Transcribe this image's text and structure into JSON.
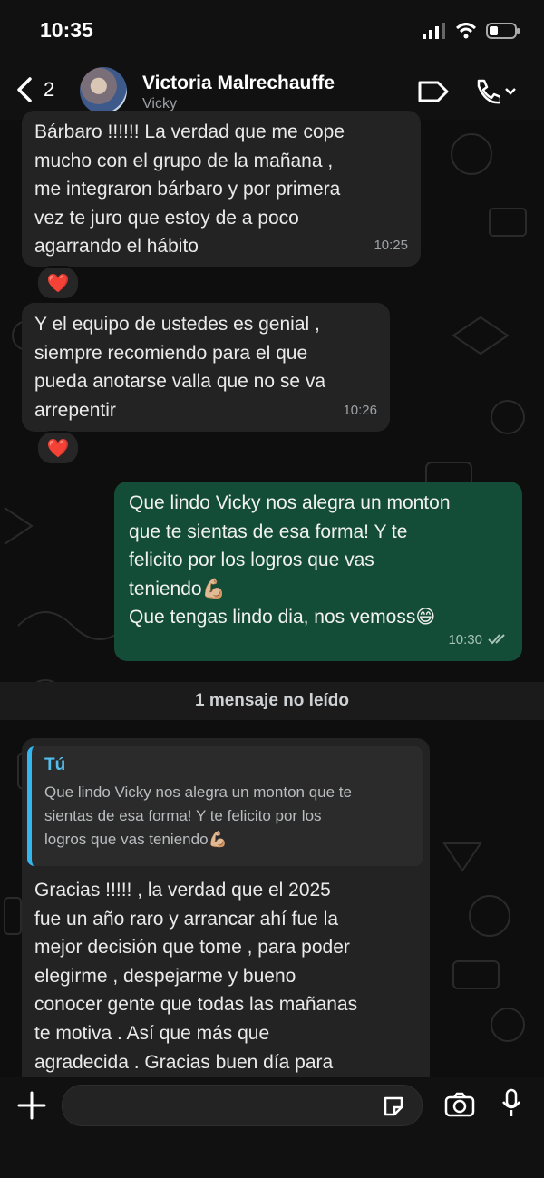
{
  "status": {
    "time": "10:35"
  },
  "header": {
    "back_count": "2",
    "contact_name": "Victoria Malrechauffe",
    "contact_subtitle": "Vicky"
  },
  "messages": [
    {
      "direction": "incoming",
      "text": "Bárbaro !!!!!! La verdad que me cope\nmucho con el grupo de la mañana ,\nme integraron bárbaro  y por primera\nvez te juro que estoy de a poco\nagarrando el hábito",
      "time": "10:25",
      "reaction": "❤️"
    },
    {
      "direction": "incoming",
      "text": "Y el equipo de ustedes es genial ,\nsiempre recomiendo para el que\npueda anotarse valla que no se va\narrepentir",
      "time": "10:26",
      "reaction": "❤️"
    },
    {
      "direction": "outgoing",
      "text": "Que lindo Vicky nos alegra un monton\nque te sientas de esa forma! Y te\nfelicito por los logros que vas\nteniendo💪🏼\nQue tengas lindo dia, nos vemoss😄",
      "time": "10:30"
    },
    {
      "direction": "incoming",
      "reply_to": {
        "author": "Tú",
        "text": "Que lindo Vicky nos alegra un monton que te\nsientas de esa forma! Y te felicito por los\nlogros que vas teniendo💪🏼"
      },
      "text": "Gracias !!!!! , la verdad que el 2025\nfue un año raro y arrancar ahí fue la\nmejor decisión que tome , para poder\nelegirme , despejarme y bueno\nconocer gente que todas las mañanas\nte motiva . Así que más que\nagradecida . Gracias  buen día para"
    }
  ],
  "unread_banner": "1 mensaje no leído",
  "colors": {
    "outgoing_bubble": "#144d37",
    "incoming_bubble": "#232323",
    "reply_accent": "#34b7f1"
  },
  "icons": {
    "back": "chevron-left-icon",
    "video": "video-call-icon",
    "call": "phone-icon",
    "add": "plus-icon",
    "sticker": "sticker-icon",
    "camera": "camera-icon",
    "mic": "microphone-icon"
  }
}
